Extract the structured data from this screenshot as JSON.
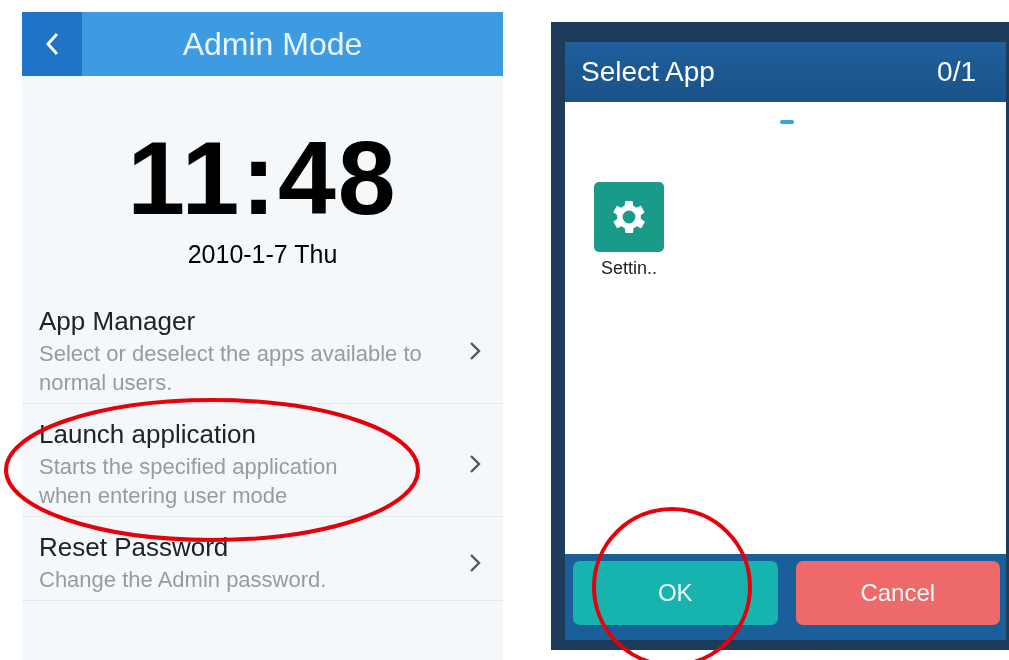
{
  "admin_screen": {
    "title": "Admin Mode",
    "clock": "11:48",
    "date": "2010-1-7 Thu",
    "items": [
      {
        "title": "App Manager",
        "subtitle": "Select or deselect the apps available to normal users."
      },
      {
        "title": "Launch application",
        "subtitle": "Starts the specified application when entering user mode"
      },
      {
        "title": "Reset Password",
        "subtitle": "Change the Admin password."
      }
    ]
  },
  "select_app_dialog": {
    "title": "Select App",
    "count": "0/1",
    "apps": [
      {
        "label": "Settin..",
        "selected": false
      }
    ],
    "buttons": [
      {
        "label": "OK",
        "kind": "confirm"
      },
      {
        "label": "Cancel",
        "kind": "cancel"
      }
    ]
  }
}
